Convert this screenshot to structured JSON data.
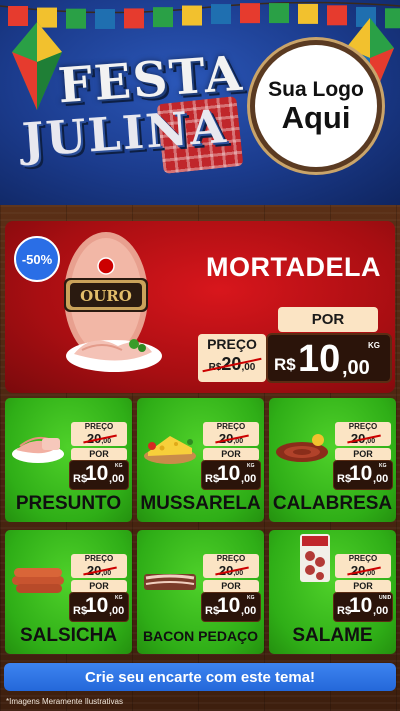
{
  "header": {
    "title_line1": "FESTA",
    "title_line2": "JULINA",
    "logo_line1": "Sua Logo",
    "logo_line2": "Aqui"
  },
  "featured": {
    "discount": "-50%",
    "name": "MORTADELA",
    "brand_label": "OURO",
    "preco_label": "PREÇO",
    "old_currency": "R$",
    "old_int": "20",
    "old_dec": ",00",
    "por_label": "POR",
    "currency": "R$",
    "price_int": "10",
    "price_dec": ",00",
    "unit": "KG"
  },
  "products": [
    {
      "name": "PRESUNTO",
      "preco_label": "PREÇO",
      "old_int": "20",
      "old_dec": ",00",
      "por_label": "POR",
      "currency": "R$",
      "price_int": "10",
      "price_dec": ",00",
      "unit": "KG",
      "icon": "ham-slices-icon"
    },
    {
      "name": "MUSSARELA",
      "preco_label": "PREÇO",
      "old_int": "20",
      "old_dec": ",00",
      "por_label": "POR",
      "currency": "R$",
      "price_int": "10",
      "price_dec": ",00",
      "unit": "KG",
      "icon": "cheese-icon"
    },
    {
      "name": "CALABRESA",
      "preco_label": "PREÇO",
      "old_int": "20",
      "old_dec": ",00",
      "por_label": "POR",
      "currency": "R$",
      "price_int": "10",
      "price_dec": ",00",
      "unit": "KG",
      "icon": "sausage-coil-icon"
    },
    {
      "name": "SALSICHA",
      "preco_label": "PREÇO",
      "old_int": "20",
      "old_dec": ",00",
      "por_label": "POR",
      "currency": "R$",
      "price_int": "10",
      "price_dec": ",00",
      "unit": "KG",
      "icon": "hotdog-sausages-icon"
    },
    {
      "name": "BACON PEDAÇO",
      "preco_label": "PREÇO",
      "old_int": "20",
      "old_dec": ",00",
      "por_label": "POR",
      "currency": "R$",
      "price_int": "10",
      "price_dec": ",00",
      "unit": "KG",
      "icon": "bacon-icon"
    },
    {
      "name": "SALAME",
      "preco_label": "PREÇO",
      "old_int": "20",
      "old_dec": ",00",
      "por_label": "POR",
      "currency": "R$",
      "price_int": "10",
      "price_dec": ",00",
      "unit": "UNID",
      "icon": "salami-package-icon"
    }
  ],
  "cta_label": "Crie seu encarte com este tema!",
  "footnote": "*Imagens Meramente Ilustrativas",
  "colors": {
    "header_blue": "#1b3b8c",
    "feature_red": "#c8141a",
    "card_green": "#3cc21f",
    "price_dark": "#2b140a",
    "tag_cream": "#fbe4c4",
    "cta_blue": "#2f78e8",
    "discount_blue": "#2a6ee6"
  }
}
